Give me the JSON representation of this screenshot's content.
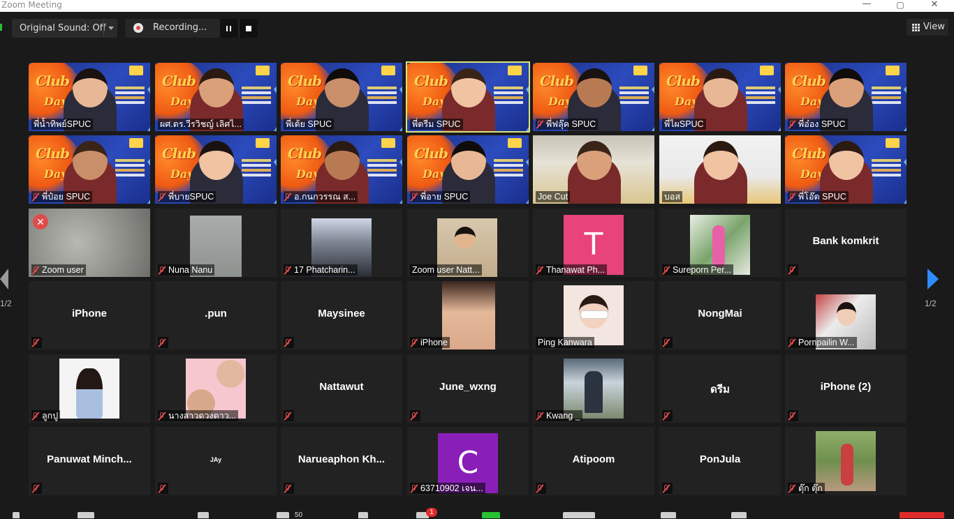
{
  "window": {
    "title": "Zoom Meeting",
    "controls": {
      "minimize": "—",
      "maximize": "▢",
      "close": "✕"
    }
  },
  "toolbar": {
    "original_sound_label": "Original Sound: Off",
    "recording_label": "Recording...",
    "view_label": "View"
  },
  "gallery": {
    "page_indicator": "1/2",
    "participants": [
      {
        "name": "พี่น้ำทิพย์SPUC",
        "type": "club",
        "muted": false,
        "active": false
      },
      {
        "name": "ผศ.ดร.วีรวิชญ์ เลิศไ...",
        "type": "club",
        "muted": false,
        "active": false
      },
      {
        "name": "พี่เต้ย SPUC",
        "type": "club",
        "muted": false,
        "active": false
      },
      {
        "name": "พี่ตรีม SPUC",
        "type": "club",
        "muted": false,
        "active": true
      },
      {
        "name": "พี่ฟลุ๊ค SPUC",
        "type": "club",
        "muted": true,
        "active": false
      },
      {
        "name": "พี่ไผSPUC",
        "type": "club",
        "muted": false,
        "active": false
      },
      {
        "name": "พี่อ๋อง SPUC",
        "type": "club",
        "muted": true,
        "active": false
      },
      {
        "name": "พี่ป๋อย SPUC",
        "type": "club",
        "muted": true,
        "active": false
      },
      {
        "name": "พี่บายSPUC",
        "type": "club",
        "muted": true,
        "active": false
      },
      {
        "name": "อ.กนกวรรณ ส...",
        "type": "club",
        "muted": true,
        "active": false
      },
      {
        "name": "พี่อาย SPUC",
        "type": "club",
        "muted": true,
        "active": false
      },
      {
        "name": "Joe Cut",
        "type": "room",
        "muted": false,
        "active": false
      },
      {
        "name": "บอส",
        "type": "room2",
        "muted": false,
        "active": false
      },
      {
        "name": "พี่โอ๊ต SPUC",
        "type": "club",
        "muted": true,
        "active": false
      },
      {
        "name": "Zoom user",
        "type": "video-gray",
        "muted": true,
        "active": false
      },
      {
        "name": "Nuna Nanu",
        "type": "video-gray2",
        "muted": true,
        "active": false
      },
      {
        "name": "17 Phatcharin...",
        "type": "photo-mirror",
        "muted": true,
        "active": false
      },
      {
        "name": "Zoom user Natt...",
        "type": "photo-selfie",
        "muted": false,
        "active": false
      },
      {
        "name": "Thanawat Ph...",
        "type": "avatar",
        "letter": "T",
        "avatar_color": "#e8437a",
        "muted": true,
        "active": false
      },
      {
        "name": "Sureporn Per...",
        "type": "photo-plant",
        "muted": true,
        "active": false
      },
      {
        "name": "Bank komkrit",
        "type": "name",
        "muted": true,
        "active": false
      },
      {
        "name": "iPhone",
        "type": "name",
        "muted": true,
        "active": false
      },
      {
        "name": ".pun",
        "type": "name",
        "muted": true,
        "active": false
      },
      {
        "name": "Maysinee",
        "type": "name",
        "muted": true,
        "active": false
      },
      {
        "name": "iPhone",
        "type": "photo-face",
        "muted": true,
        "active": false
      },
      {
        "name": "Ping Kanwara",
        "type": "photo-sunglass",
        "muted": false,
        "active": false
      },
      {
        "name": "NongMai",
        "type": "name",
        "muted": true,
        "active": false
      },
      {
        "name": "Pornpailin W...",
        "type": "photo-girl",
        "muted": true,
        "active": false
      },
      {
        "name": "ลูกปู",
        "type": "photo-portrait",
        "muted": true,
        "active": false
      },
      {
        "name": "นางสาวดวงดาว...",
        "type": "photo-collage",
        "muted": true,
        "active": false
      },
      {
        "name": "Nattawut",
        "type": "name",
        "muted": true,
        "active": false
      },
      {
        "name": "June_wxng",
        "type": "name",
        "muted": true,
        "active": false
      },
      {
        "name": "Kwang _",
        "type": "photo-outdoor",
        "muted": true,
        "active": false
      },
      {
        "name": "ดรีม",
        "type": "name",
        "muted": true,
        "active": false
      },
      {
        "name": "iPhone (2)",
        "type": "name",
        "muted": true,
        "active": false
      },
      {
        "name": "Panuwat  Minch...",
        "type": "name",
        "muted": true,
        "active": false
      },
      {
        "name": "JAy",
        "type": "name-tiny",
        "muted": true,
        "active": false
      },
      {
        "name": "Narueaphon  Kh...",
        "type": "name",
        "muted": true,
        "active": false
      },
      {
        "name": "63710902 เจน...",
        "type": "avatar",
        "letter": "C",
        "avatar_color": "#8a1fb8",
        "muted": true,
        "active": false
      },
      {
        "name": "Atipoom",
        "type": "name",
        "muted": true,
        "active": false
      },
      {
        "name": "PonJula",
        "type": "name",
        "muted": true,
        "active": false
      },
      {
        "name": "ตุ๊ก ตุ๊ก",
        "type": "photo-garden",
        "muted": true,
        "active": false
      }
    ]
  },
  "bottom_bar": {
    "participants_count": "50",
    "chat_badge": "1"
  },
  "colors": {
    "accent": "#2d8cff",
    "active_speaker": "#d8e37a",
    "muted": "#e04c4c"
  }
}
